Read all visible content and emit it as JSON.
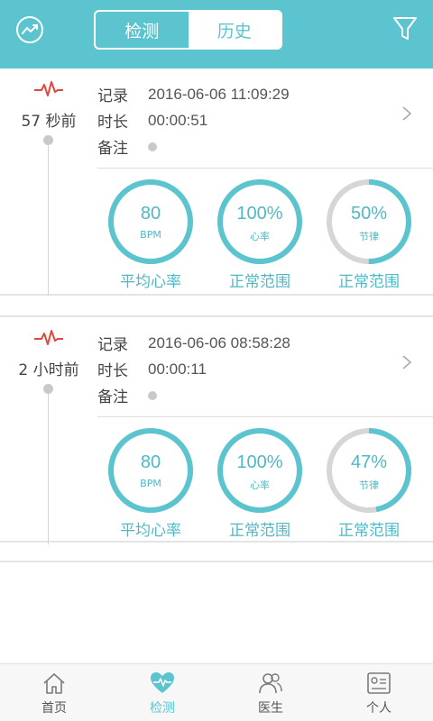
{
  "header": {
    "tabs": [
      {
        "label": "检测",
        "active": false
      },
      {
        "label": "历史",
        "active": true
      }
    ],
    "left_icon": "trend-chart-icon",
    "right_icon": "filter-icon",
    "accent_color": "#5cc4cf"
  },
  "records": [
    {
      "time_ago": "57 秒前",
      "record_label": "记录",
      "record_value": "2016-06-06 11:09:29",
      "duration_label": "时长",
      "duration_value": "00:00:51",
      "note_label": "备注",
      "metrics": [
        {
          "value": "80",
          "unit": "BPM",
          "caption": "平均心率",
          "progress": 1.0
        },
        {
          "value": "100%",
          "unit": "心率",
          "caption": "正常范围",
          "progress": 1.0
        },
        {
          "value": "50%",
          "unit": "节律",
          "caption": "正常范围",
          "progress": 0.5
        }
      ]
    },
    {
      "time_ago": "2 小时前",
      "record_label": "记录",
      "record_value": "2016-06-06 08:58:28",
      "duration_label": "时长",
      "duration_value": "00:00:11",
      "note_label": "备注",
      "metrics": [
        {
          "value": "80",
          "unit": "BPM",
          "caption": "平均心率",
          "progress": 1.0
        },
        {
          "value": "100%",
          "unit": "心率",
          "caption": "正常范围",
          "progress": 1.0
        },
        {
          "value": "47%",
          "unit": "节律",
          "caption": "正常范围",
          "progress": 0.47
        }
      ]
    }
  ],
  "tabbar": {
    "items": [
      {
        "label": "首页",
        "icon": "home-icon",
        "active": false
      },
      {
        "label": "检测",
        "icon": "heart-pulse-icon",
        "active": true
      },
      {
        "label": "医生",
        "icon": "doctors-icon",
        "active": false
      },
      {
        "label": "个人",
        "icon": "profile-card-icon",
        "active": false
      }
    ]
  },
  "colors": {
    "accent": "#5cc4cf",
    "gauge_track": "#d6d6d6",
    "pulse": "#e0483e"
  }
}
